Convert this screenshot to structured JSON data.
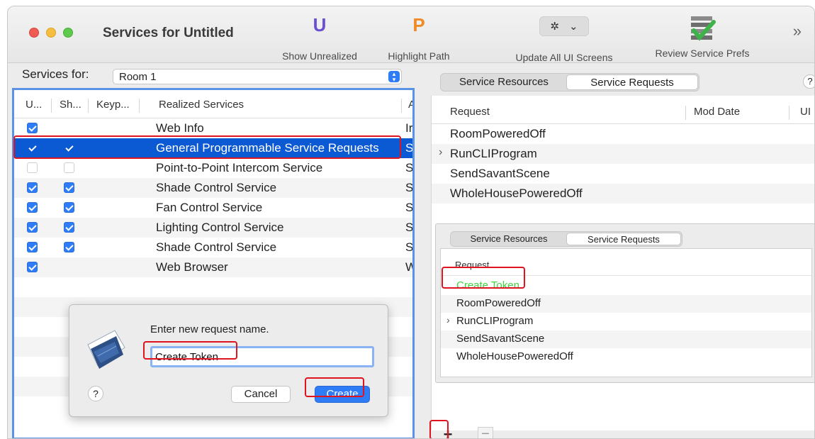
{
  "window": {
    "title": "Services for Untitled"
  },
  "toolbar": {
    "show_unrealized": {
      "glyph": "U",
      "label": "Show Unrealized"
    },
    "highlight_path": {
      "glyph": "P",
      "label": "Highlight Path"
    },
    "update_all": {
      "label": "Update All UI Screens",
      "gear": "✲",
      "chevron": "⌄"
    },
    "review_prefs": {
      "label": "Review Service Prefs"
    },
    "overflow": "»"
  },
  "services_for": {
    "label": "Services for:",
    "selected": "Room 1"
  },
  "services_table": {
    "columns": [
      "U...",
      "Sh...",
      "Keyp...",
      "Realized Services",
      "A"
    ],
    "rows": [
      {
        "u": true,
        "sh": false,
        "name": "Web Info",
        "extra": "Ir"
      },
      {
        "u": true,
        "sh": true,
        "name": "General Programmable Service Requests",
        "extra": "S",
        "selected": true
      },
      {
        "u": false,
        "sh": false,
        "name": "Point-to-Point Intercom Service",
        "extra": "S"
      },
      {
        "u": true,
        "sh": true,
        "name": "Shade Control Service",
        "extra": "S"
      },
      {
        "u": true,
        "sh": true,
        "name": "Fan Control Service",
        "extra": "S"
      },
      {
        "u": true,
        "sh": true,
        "name": "Lighting Control Service",
        "extra": "S"
      },
      {
        "u": true,
        "sh": true,
        "name": "Shade Control Service",
        "extra": "S"
      },
      {
        "u": true,
        "sh": false,
        "name": "Web Browser",
        "extra": "W"
      }
    ]
  },
  "dialog": {
    "prompt": "Enter new request name.",
    "input_value": "Create Token",
    "help": "?",
    "cancel": "Cancel",
    "create": "Create"
  },
  "right_panel": {
    "tabs": [
      "Service Resources",
      "Service Requests"
    ],
    "help": "?",
    "columns": [
      "Request",
      "Mod Date",
      "UI"
    ],
    "rows": [
      {
        "name": "RoomPoweredOff",
        "expandable": false
      },
      {
        "name": "RunCLIProgram",
        "expandable": true
      },
      {
        "name": "SendSavantScene",
        "expandable": false
      },
      {
        "name": "WholeHousePoweredOff",
        "expandable": false
      }
    ],
    "chevron": "›"
  },
  "inner_panel": {
    "tabs": [
      "Service Resources",
      "Service Requests"
    ],
    "column": "Request",
    "rows": [
      {
        "name": "Create Token",
        "expandable": false,
        "new": true
      },
      {
        "name": "RoomPoweredOff",
        "expandable": false
      },
      {
        "name": "RunCLIProgram",
        "expandable": true
      },
      {
        "name": "SendSavantScene",
        "expandable": false
      },
      {
        "name": "WholeHousePoweredOff",
        "expandable": false
      }
    ]
  },
  "footer": {
    "add": "+",
    "remove": "−"
  },
  "colors": {
    "accent": "#2f7df6",
    "selection": "#0c59d4",
    "highlight_outline": "#e0141e",
    "new_item": "#3ed23e"
  }
}
